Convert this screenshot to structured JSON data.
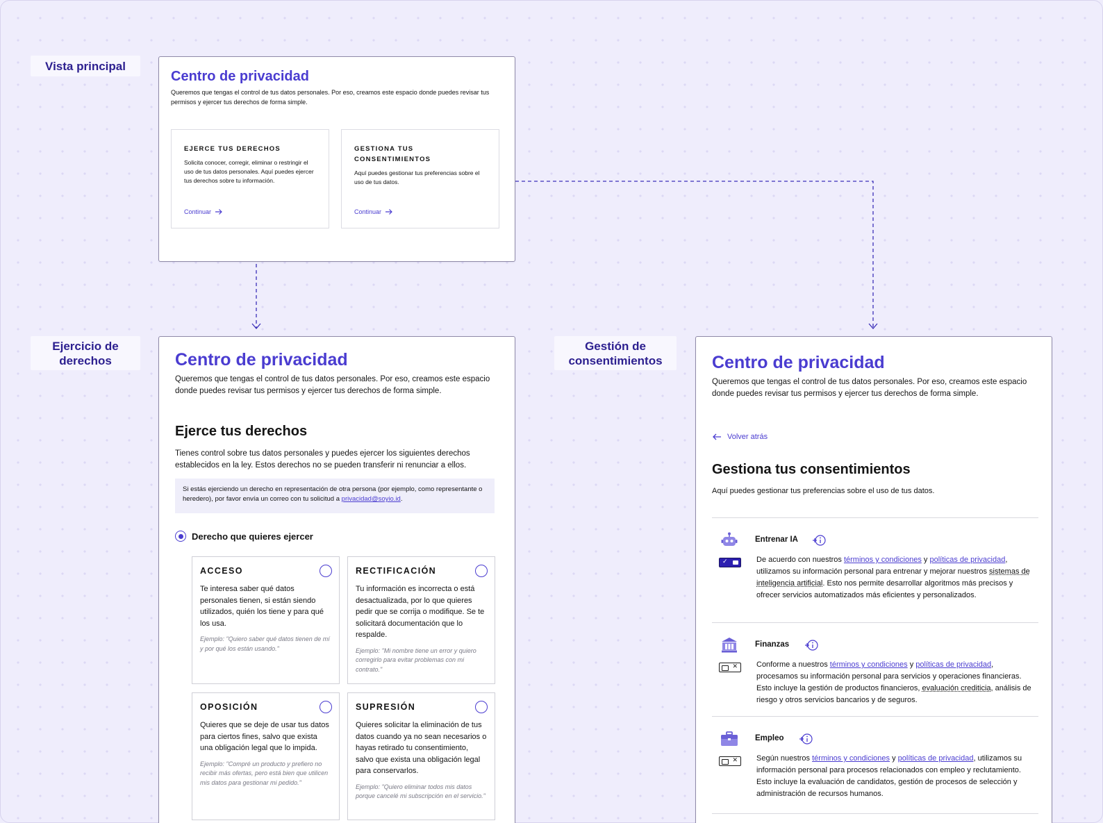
{
  "labels": {
    "main_view": "Vista principal",
    "rights_view": "Ejercicio de derechos",
    "consent_view": "Gestión de consentimientos"
  },
  "colors": {
    "accent": "#4a3cd0",
    "label_text": "#2c1f8f",
    "canvas": "#efedfc"
  },
  "common": {
    "title": "Centro de privacidad",
    "intro": "Queremos que tengas el control de tus datos personales. Por eso, creamos este espacio donde puedes revisar tus permisos y ejercer tus derechos de forma simple."
  },
  "main": {
    "cards": [
      {
        "title": "EJERCE TUS DERECHOS",
        "desc": "Solicita conocer, corregir, eliminar o restringir el uso de tus datos personales. Aquí puedes ejercer tus derechos sobre tu información.",
        "cta": "Continuar"
      },
      {
        "title": "GESTIONA TUS CONSENTIMIENTOS",
        "desc": "Aquí puedes gestionar tus preferencias sobre el uso de tus datos.",
        "cta": "Continuar"
      }
    ]
  },
  "rights": {
    "heading": "Ejerce tus derechos",
    "desc": "Tienes control sobre tus datos personales y puedes ejercer los siguientes derechos establecidos en la ley. Estos derechos no se pueden transferir ni renunciar a ellos.",
    "note_pre": "Si estás ejerciendo un derecho en representación de otra persona (por ejemplo, como representante o heredero), por favor envía un correo con tu solicitud a ",
    "note_email": "privacidad@soyio.id",
    "note_post": ".",
    "radio_label": "Derecho que quieres ejercer",
    "options": [
      {
        "title": "ACCESO",
        "desc": "Te interesa saber qué datos personales tienen, si están siendo utilizados, quién los tiene y para qué los usa.",
        "example": "Ejemplo: \"Quiero saber qué datos tienen de mí y por qué los están usando.\""
      },
      {
        "title": "RECTIFICACIÓN",
        "desc": "Tu información es incorrecta o está desactualizada, por lo que quieres pedir que se corrija o modifique. Se te solicitará documentación que lo respalde.",
        "example": "Ejemplo: \"Mi nombre tiene un error y quiero corregirlo para evitar problemas con mi contrato.\""
      },
      {
        "title": "OPOSICIÓN",
        "desc": "Quieres que se deje de usar tus datos para ciertos fines, salvo que exista una obligación legal que lo impida.",
        "example": "Ejemplo: \"Compré un producto y prefiero no recibir más ofertas, pero está bien que utilicen mis datos para gestionar mi pedido.\""
      },
      {
        "title": "SUPRESIÓN",
        "desc": "Quieres solicitar la eliminación de tus datos cuando ya no sean necesarios o hayas retirado tu consentimiento, salvo que exista una obligación legal para conservarlos.",
        "example": "Ejemplo: \"Quiero eliminar todos mis datos porque cancelé mi subscripción en el servicio.\""
      }
    ]
  },
  "consent": {
    "back": "Volver atrás",
    "heading": "Gestiona tus consentimientos",
    "desc": "Aquí puedes gestionar tus preferencias sobre el uso de tus datos.",
    "link_terms": "términos y condiciones",
    "link_privacy": "políticas de privacidad",
    "items": [
      {
        "name": "Entrenar IA",
        "icon": "robot-icon",
        "enabled": true,
        "t1": "De acuerdo con nuestros ",
        "t2": " y ",
        "t3": ", utilizamos su información personal para entrenar y mejorar nuestros ",
        "t4": "sistemas de inteligencia artificial",
        "t5": ". Esto nos permite desarrollar algoritmos más precisos y ofrecer servicios automatizados más eficientes y personalizados."
      },
      {
        "name": "Finanzas",
        "icon": "bank-icon",
        "enabled": false,
        "t1": "Conforme a nuestros ",
        "t2": " y ",
        "t3": ", procesamos su información personal para servicios y operaciones financieras. Esto incluye la gestión de productos financieros, ",
        "t4": "evaluación crediticia",
        "t5": ", análisis de riesgo y otros servicios bancarios y de seguros."
      },
      {
        "name": "Empleo",
        "icon": "briefcase-icon",
        "enabled": false,
        "t1": "Según nuestros ",
        "t2": " y ",
        "t3": ", utilizamos su información personal para procesos relacionados con empleo y reclutamiento. Esto incluye la evaluación de candidatos, gestión de procesos de selección y administración de recursos humanos.",
        "t4": "",
        "t5": ""
      }
    ]
  }
}
